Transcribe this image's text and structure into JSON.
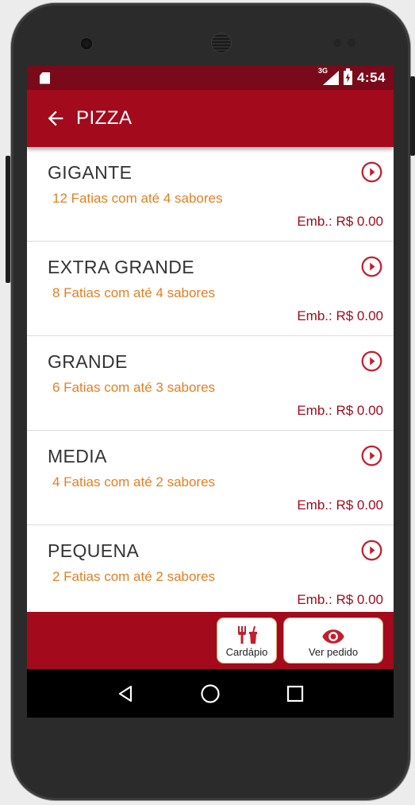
{
  "status_bar": {
    "network": "3G",
    "time": "4:54",
    "icons": [
      "sd-card-icon",
      "signal-icon",
      "battery-charging-icon"
    ]
  },
  "toolbar": {
    "title": "PIZZA",
    "back_icon": "arrow-left-icon"
  },
  "items": [
    {
      "name": "GIGANTE",
      "description": "12 Fatias com até 4 sabores",
      "price": "Emb.: R$ 0.00"
    },
    {
      "name": "EXTRA GRANDE",
      "description": "8 Fatias com até 4 sabores",
      "price": "Emb.: R$ 0.00"
    },
    {
      "name": "GRANDE",
      "description": "6 Fatias com até 3 sabores",
      "price": "Emb.: R$ 0.00"
    },
    {
      "name": "MEDIA",
      "description": "4 Fatias com até 2 sabores",
      "price": "Emb.: R$ 0.00"
    },
    {
      "name": "PEQUENA",
      "description": "2 Fatias com até 2 sabores",
      "price": "Emb.: R$ 0.00"
    }
  ],
  "bottom_bar": {
    "cardapio_label": "Cardápio",
    "pedido_label": "Ver pedido"
  },
  "colors": {
    "primary": "#a30a1c",
    "status_bar": "#7a0a1a",
    "description": "#e67e22",
    "price": "#a30a1c"
  }
}
